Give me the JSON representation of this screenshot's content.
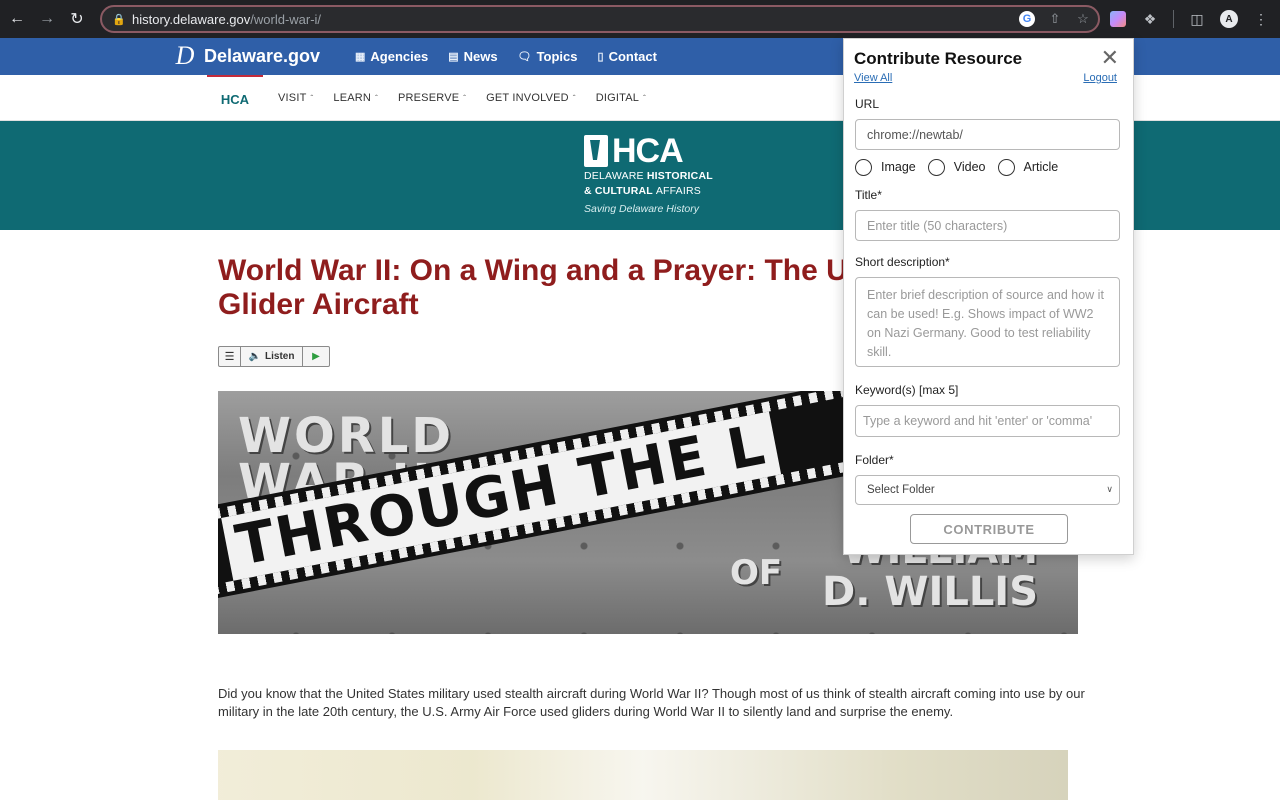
{
  "browser": {
    "url_host": "history.delaware.gov",
    "url_path": "/world-war-i/",
    "profile_initial": "A"
  },
  "de_nav": {
    "logo_text": "Delaware.gov",
    "logo_mark": "D",
    "links": [
      {
        "label": "Agencies",
        "icon": "building-icon"
      },
      {
        "label": "News",
        "icon": "newspaper-icon"
      },
      {
        "label": "Topics",
        "icon": "chat-bubbles-icon"
      },
      {
        "label": "Contact",
        "icon": "phone-icon"
      }
    ]
  },
  "hca_nav": {
    "home": "HCA",
    "items": [
      "VISIT",
      "LEARN",
      "PRESERVE",
      "GET INVOLVED",
      "DIGITAL"
    ]
  },
  "banner": {
    "letters": "HCA",
    "line1_a": "DELAWARE ",
    "line1_b": "HISTORICAL",
    "line2_a": "& CULTURAL ",
    "line2_b": "AFFAIRS",
    "tagline": "Saving Delaware History"
  },
  "article": {
    "title_line1": "World War II: On a Wing and a Prayer: The U",
    "title_line2": "Glider Aircraft",
    "listen_label": "Listen",
    "hero": {
      "line1": "WORLD",
      "line2": "WAR II",
      "film_text": "THROUGH THE L",
      "of": "OF",
      "name1": "WILLIAM",
      "name2": "D. WILLIS"
    },
    "paragraph": "Did you know that the United States military used stealth aircraft during World War II? Though most of us think of stealth aircraft coming into use by our military in the late 20th century, the U.S. Army Air Force used gliders during World War II to silently land and surprise the enemy."
  },
  "modal": {
    "title": "Contribute Resource",
    "view_all": "View All",
    "logout": "Logout",
    "url_label": "URL",
    "url_value": "chrome://newtab/",
    "types": [
      "Image",
      "Video",
      "Article"
    ],
    "title_label": "Title*",
    "title_placeholder": "Enter title (50 characters)",
    "desc_label": "Short description*",
    "desc_placeholder": "Enter brief description of source and how it can be used! E.g. Shows impact of WW2 on Nazi Germany. Good to test reliability skill.",
    "keywords_label": "Keyword(s) [max 5]",
    "keywords_placeholder": "Type a keyword and hit 'enter' or 'comma'",
    "folder_label": "Folder*",
    "folder_value": "Select Folder",
    "submit": "CONTRIBUTE"
  }
}
